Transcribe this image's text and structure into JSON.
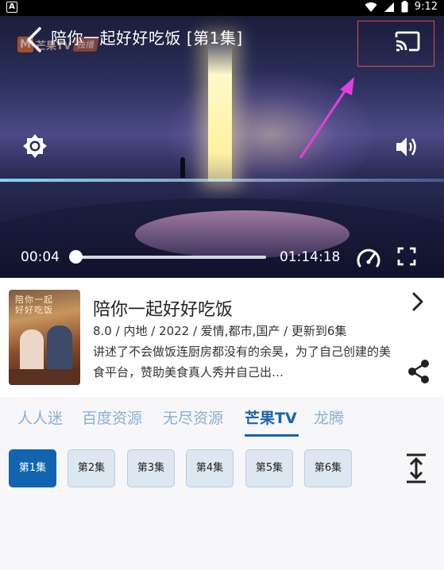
{
  "status_bar": {
    "time": "9:12",
    "app_badge": "A"
  },
  "player": {
    "title": "陪你一起好好吃饭 [第1集]",
    "logo": {
      "mark": "M",
      "brand": "芒果TV",
      "badge": "独播"
    },
    "current_time": "00:04",
    "total_time": "01:14:18",
    "progress": 0.0009,
    "icons": {
      "back": "back-arrow-icon",
      "cast": "cast-icon",
      "brightness": "brightness-icon",
      "volume": "volume-icon",
      "speed": "speed-gauge-icon",
      "fullscreen": "fullscreen-icon"
    },
    "highlight_color": "#e14a4a",
    "annotation_arrow_color": "#e040e0"
  },
  "show": {
    "name": "陪你一起好好吃饭",
    "meta": "8.0 / 内地 / 2022 / 爱情,都市,国产 / 更新到6集",
    "description": "讲述了不会做饭连厨房都没有的余昊，为了自己创建的美食平台，赞助美食真人秀并自己出…",
    "poster_title_line1": "陪你一起",
    "poster_title_line2": "好好吃饭"
  },
  "sources": {
    "tabs": [
      "人人迷",
      "百度资源",
      "无尽资源",
      "芒果TV",
      "龙腾"
    ],
    "active_index": 3,
    "active_color": "#1a64a8",
    "inactive_color": "#8ab0cf"
  },
  "episodes": {
    "items": [
      "第1集",
      "第2集",
      "第3集",
      "第4集",
      "第5集",
      "第6集"
    ],
    "active_index": 0,
    "active_color": "#1264ae"
  }
}
